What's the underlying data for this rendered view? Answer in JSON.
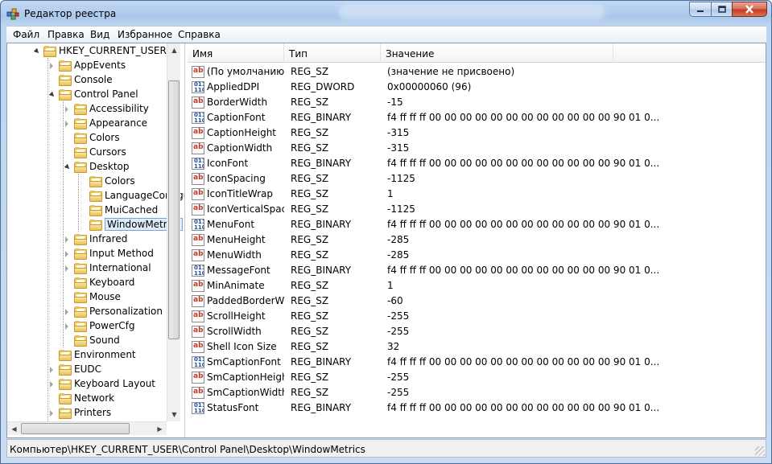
{
  "window": {
    "title": "Редактор реестра"
  },
  "menu": [
    "Файл",
    "Правка",
    "Вид",
    "Избранное",
    "Справка"
  ],
  "tree": [
    {
      "label": "HKEY_CURRENT_USER",
      "level": 0,
      "state": "expanded"
    },
    {
      "label": "AppEvents",
      "level": 1,
      "state": "collapsed"
    },
    {
      "label": "Console",
      "level": 1,
      "state": "leaf"
    },
    {
      "label": "Control Panel",
      "level": 1,
      "state": "expanded"
    },
    {
      "label": "Accessibility",
      "level": 2,
      "state": "collapsed"
    },
    {
      "label": "Appearance",
      "level": 2,
      "state": "collapsed"
    },
    {
      "label": "Colors",
      "level": 2,
      "state": "leaf"
    },
    {
      "label": "Cursors",
      "level": 2,
      "state": "leaf"
    },
    {
      "label": "Desktop",
      "level": 2,
      "state": "expanded"
    },
    {
      "label": "Colors",
      "level": 3,
      "state": "leaf"
    },
    {
      "label": "LanguageConfiguration",
      "level": 3,
      "state": "leaf"
    },
    {
      "label": "MuiCached",
      "level": 3,
      "state": "leaf"
    },
    {
      "label": "WindowMetrics",
      "level": 3,
      "state": "leaf",
      "selected": true
    },
    {
      "label": "Infrared",
      "level": 2,
      "state": "collapsed"
    },
    {
      "label": "Input Method",
      "level": 2,
      "state": "collapsed"
    },
    {
      "label": "International",
      "level": 2,
      "state": "collapsed"
    },
    {
      "label": "Keyboard",
      "level": 2,
      "state": "leaf"
    },
    {
      "label": "Mouse",
      "level": 2,
      "state": "leaf"
    },
    {
      "label": "Personalization",
      "level": 2,
      "state": "collapsed"
    },
    {
      "label": "PowerCfg",
      "level": 2,
      "state": "collapsed"
    },
    {
      "label": "Sound",
      "level": 2,
      "state": "leaf"
    },
    {
      "label": "Environment",
      "level": 1,
      "state": "leaf"
    },
    {
      "label": "EUDC",
      "level": 1,
      "state": "collapsed"
    },
    {
      "label": "Keyboard Layout",
      "level": 1,
      "state": "collapsed"
    },
    {
      "label": "Network",
      "level": 1,
      "state": "leaf"
    },
    {
      "label": "Printers",
      "level": 1,
      "state": "collapsed"
    }
  ],
  "columns": [
    "Имя",
    "Тип",
    "Значение"
  ],
  "values": [
    {
      "name": "(По умолчанию)",
      "type": "REG_SZ",
      "data": "(значение не присвоено)",
      "icon": "sz"
    },
    {
      "name": "AppliedDPI",
      "type": "REG_DWORD",
      "data": "0x00000060 (96)",
      "icon": "bin"
    },
    {
      "name": "BorderWidth",
      "type": "REG_SZ",
      "data": "-15",
      "icon": "sz"
    },
    {
      "name": "CaptionFont",
      "type": "REG_BINARY",
      "data": "f4 ff ff ff 00 00 00 00 00 00 00 00 00 00 00 00 90 01 0...",
      "icon": "bin"
    },
    {
      "name": "CaptionHeight",
      "type": "REG_SZ",
      "data": "-315",
      "icon": "sz"
    },
    {
      "name": "CaptionWidth",
      "type": "REG_SZ",
      "data": "-315",
      "icon": "sz"
    },
    {
      "name": "IconFont",
      "type": "REG_BINARY",
      "data": "f4 ff ff ff 00 00 00 00 00 00 00 00 00 00 00 00 90 01 0...",
      "icon": "bin"
    },
    {
      "name": "IconSpacing",
      "type": "REG_SZ",
      "data": "-1125",
      "icon": "sz"
    },
    {
      "name": "IconTitleWrap",
      "type": "REG_SZ",
      "data": "1",
      "icon": "sz"
    },
    {
      "name": "IconVerticalSpac...",
      "type": "REG_SZ",
      "data": "-1125",
      "icon": "sz"
    },
    {
      "name": "MenuFont",
      "type": "REG_BINARY",
      "data": "f4 ff ff ff 00 00 00 00 00 00 00 00 00 00 00 00 90 01 0...",
      "icon": "bin"
    },
    {
      "name": "MenuHeight",
      "type": "REG_SZ",
      "data": "-285",
      "icon": "sz"
    },
    {
      "name": "MenuWidth",
      "type": "REG_SZ",
      "data": "-285",
      "icon": "sz"
    },
    {
      "name": "MessageFont",
      "type": "REG_BINARY",
      "data": "f4 ff ff ff 00 00 00 00 00 00 00 00 00 00 00 00 90 01 0...",
      "icon": "bin"
    },
    {
      "name": "MinAnimate",
      "type": "REG_SZ",
      "data": "1",
      "icon": "sz"
    },
    {
      "name": "PaddedBorderW...",
      "type": "REG_SZ",
      "data": "-60",
      "icon": "sz"
    },
    {
      "name": "ScrollHeight",
      "type": "REG_SZ",
      "data": "-255",
      "icon": "sz"
    },
    {
      "name": "ScrollWidth",
      "type": "REG_SZ",
      "data": "-255",
      "icon": "sz"
    },
    {
      "name": "Shell Icon Size",
      "type": "REG_SZ",
      "data": "32",
      "icon": "sz"
    },
    {
      "name": "SmCaptionFont",
      "type": "REG_BINARY",
      "data": "f4 ff ff ff 00 00 00 00 00 00 00 00 00 00 00 00 90 01 0...",
      "icon": "bin"
    },
    {
      "name": "SmCaptionHeight",
      "type": "REG_SZ",
      "data": "-255",
      "icon": "sz"
    },
    {
      "name": "SmCaptionWidth",
      "type": "REG_SZ",
      "data": "-255",
      "icon": "sz"
    },
    {
      "name": "StatusFont",
      "type": "REG_BINARY",
      "data": "f4 ff ff ff 00 00 00 00 00 00 00 00 00 00 00 00 90 01 0...",
      "icon": "bin"
    }
  ],
  "status": {
    "path": "Компьютер\\HKEY_CURRENT_USER\\Control Panel\\Desktop\\WindowMetrics"
  },
  "colors": {
    "selection": "#dcecfc",
    "folder": "#e9bf55",
    "string_icon": "#c03a2c",
    "binary_icon": "#1e4fa0"
  }
}
